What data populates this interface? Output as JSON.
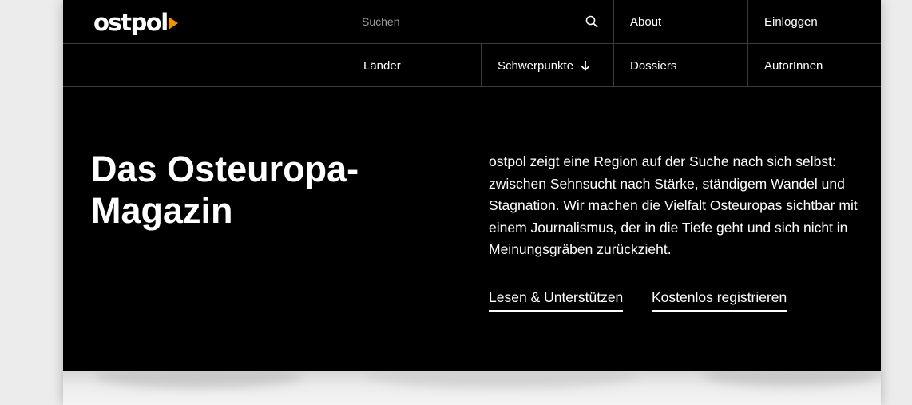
{
  "brand": {
    "logo_text": "ostpol",
    "accent_color": "#f39200"
  },
  "search": {
    "placeholder": "Suchen",
    "value": "",
    "icon": "search-icon"
  },
  "nav": {
    "top": [
      {
        "label": "About"
      },
      {
        "label": "Einloggen"
      }
    ],
    "main": [
      {
        "label": "Länder"
      },
      {
        "label": "Schwerpunkte",
        "icon": "arrow-down-icon"
      },
      {
        "label": "Dossiers"
      },
      {
        "label": "AutorInnen"
      }
    ]
  },
  "hero": {
    "title": "Das Osteuropa-Magazin",
    "text": "ostpol zeigt eine Region auf der Suche nach sich selbst: zwischen Sehnsucht nach Stärke, ständigem Wandel und Stagnation. Wir machen die Vielfalt Osteuropas sichtbar mit einem Journalismus, der in die Tiefe geht und sich nicht in Meinungsgräben zurückzieht.",
    "cta_primary": "Lesen & Unterstützen",
    "cta_secondary": "Kostenlos registrieren"
  },
  "colors": {
    "background": "#000000",
    "text": "#ffffff",
    "divider": "#3a3a3a",
    "outer": "#ececec"
  }
}
